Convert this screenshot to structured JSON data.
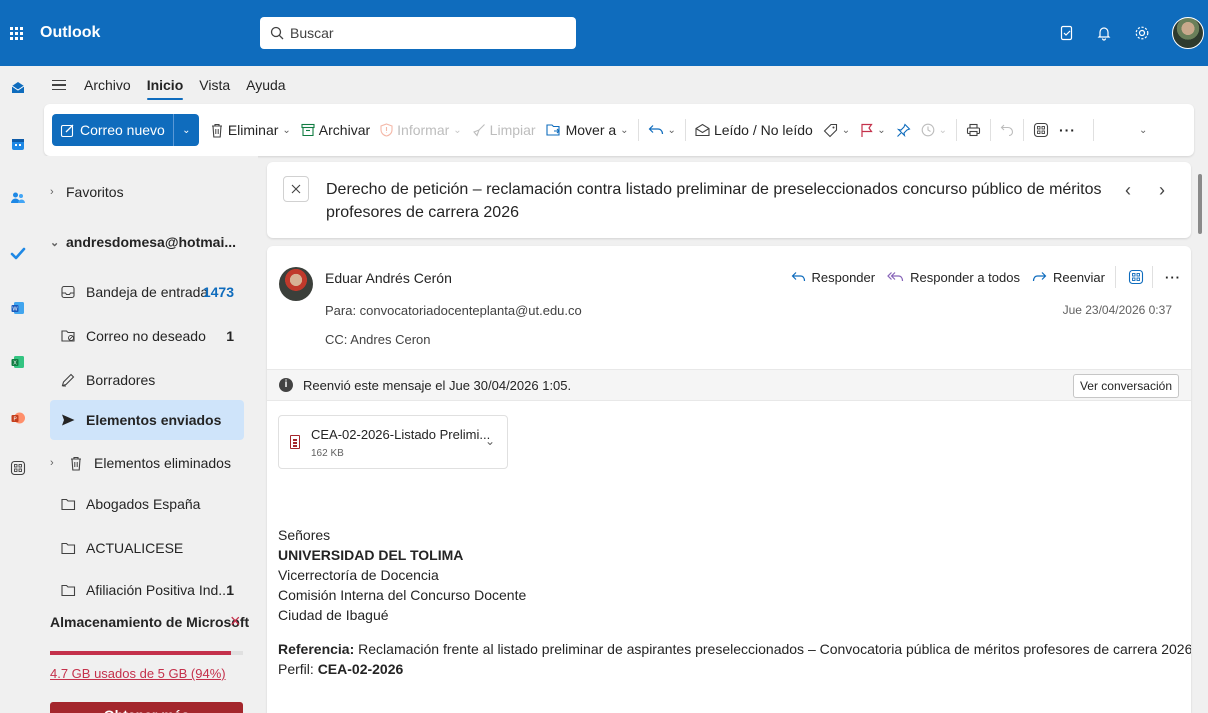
{
  "app": {
    "name": "Outlook"
  },
  "search": {
    "placeholder": "Buscar"
  },
  "menu": {
    "tabs": [
      "Archivo",
      "Inicio",
      "Vista",
      "Ayuda"
    ],
    "active": "Inicio"
  },
  "toolbar": {
    "new_mail": "Correo nuevo",
    "delete": "Eliminar",
    "archive": "Archivar",
    "report": "Informar",
    "sweep": "Limpiar",
    "move_to": "Mover a",
    "read_unread": "Leído / No leído",
    "more": "···"
  },
  "folders": {
    "favorites": "Favoritos",
    "account": "andresdomesa@hotmai...",
    "items": [
      {
        "label": "Bandeja de entrada",
        "count": "1473"
      },
      {
        "label": "Correo no deseado",
        "count": "1"
      },
      {
        "label": "Borradores",
        "count": ""
      },
      {
        "label": "Elementos enviados",
        "count": ""
      },
      {
        "label": "Elementos eliminados",
        "count": ""
      },
      {
        "label": "Abogados España",
        "count": ""
      },
      {
        "label": "ACTUALICESE",
        "count": ""
      },
      {
        "label": "Afiliación Positiva Ind...",
        "count": "1"
      }
    ],
    "selected": "Elementos enviados"
  },
  "storage": {
    "title": "Almacenamiento de Microsoft",
    "used": "4.7 GB usados de 5 GB (94%)",
    "fraction": 0.94,
    "button": "Obtener más"
  },
  "message": {
    "subject": "Derecho de petición – reclamación contra listado preliminar de preseleccionados concurso público de méritos profesores de carrera 2026",
    "sender": "Eduar Andrés Cerón",
    "to": "Para: convocatoriadocenteplanta@ut.edu.co",
    "cc": "CC: Andres Ceron",
    "date": "Jue 23/04/2026 0:37",
    "reply": "Responder",
    "reply_all": "Responder a todos",
    "forward": "Reenviar",
    "forwarded_note": "Reenvió este mensaje el Jue 30/04/2026 1:05.",
    "view_conversation": "Ver conversación",
    "attachment": {
      "name": "CEA-02-2026-Listado Prelimi...",
      "size": "162 KB"
    },
    "body": {
      "l1": "Señores",
      "l2": "UNIVERSIDAD DEL TOLIMA",
      "l3": "Vicerrectoría de Docencia",
      "l4": "Comisión Interna del Concurso Docente",
      "l5": "Ciudad de Ibagué",
      "ref_label": "Referencia:",
      "ref_text": " Reclamación frente al listado preliminar de aspirantes preseleccionados – Convocatoria pública de méritos profesores de carrera 2026",
      "profile_label": "Perfil: ",
      "profile_value": "CEA-02-2026"
    }
  },
  "colors": {
    "brand": "#0f6cbd",
    "selected": "#cfe4fa",
    "warning": "#c4314b"
  }
}
